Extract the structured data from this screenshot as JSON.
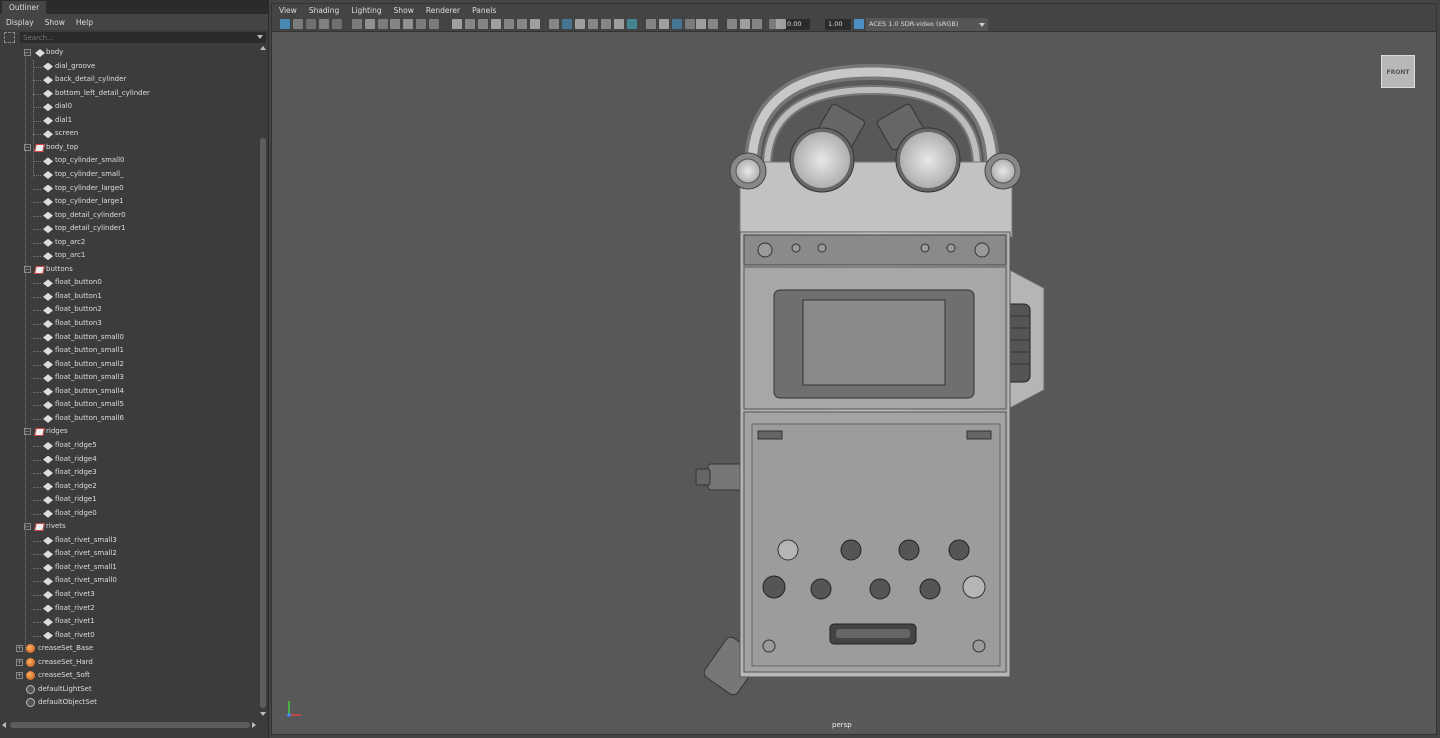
{
  "outliner": {
    "tab": "Outliner",
    "menu": [
      "Display",
      "Show",
      "Help"
    ],
    "search_placeholder": "Search...",
    "tree": [
      {
        "label": "body",
        "type": "mesh",
        "depth": 1,
        "expander": "⊟"
      },
      {
        "label": "dial_groove",
        "type": "mesh",
        "depth": 2
      },
      {
        "label": "back_detail_cylinder",
        "type": "mesh",
        "depth": 2
      },
      {
        "label": "bottom_left_detail_cylinder",
        "type": "mesh",
        "depth": 2
      },
      {
        "label": "dial0",
        "type": "mesh",
        "depth": 2
      },
      {
        "label": "dial1",
        "type": "mesh",
        "depth": 2
      },
      {
        "label": "screen",
        "type": "mesh",
        "depth": 2
      },
      {
        "label": "body_top",
        "type": "group",
        "depth": 1,
        "expander": "⊟"
      },
      {
        "label": "top_cylinder_small0",
        "type": "mesh",
        "depth": 2
      },
      {
        "label": "top_cylinder_small_",
        "type": "mesh",
        "depth": 2
      },
      {
        "label": "top_cylinder_large0",
        "type": "mesh",
        "depth": 2
      },
      {
        "label": "top_cylinder_large1",
        "type": "mesh",
        "depth": 2
      },
      {
        "label": "top_detail_cylinder0",
        "type": "mesh",
        "depth": 2
      },
      {
        "label": "top_detail_cylinder1",
        "type": "mesh",
        "depth": 2
      },
      {
        "label": "top_arc2",
        "type": "mesh",
        "depth": 2
      },
      {
        "label": "top_arc1",
        "type": "mesh",
        "depth": 2
      },
      {
        "label": "buttons",
        "type": "group",
        "depth": 1,
        "expander": "⊟"
      },
      {
        "label": "float_button0",
        "type": "mesh",
        "depth": 2
      },
      {
        "label": "float_button1",
        "type": "mesh",
        "depth": 2
      },
      {
        "label": "float_button2",
        "type": "mesh",
        "depth": 2
      },
      {
        "label": "float_button3",
        "type": "mesh",
        "depth": 2
      },
      {
        "label": "float_button_small0",
        "type": "mesh",
        "depth": 2
      },
      {
        "label": "float_button_small1",
        "type": "mesh",
        "depth": 2
      },
      {
        "label": "float_button_small2",
        "type": "mesh",
        "depth": 2
      },
      {
        "label": "float_button_small3",
        "type": "mesh",
        "depth": 2
      },
      {
        "label": "float_button_small4",
        "type": "mesh",
        "depth": 2
      },
      {
        "label": "float_button_small5",
        "type": "mesh",
        "depth": 2
      },
      {
        "label": "float_button_small6",
        "type": "mesh",
        "depth": 2
      },
      {
        "label": "ridges",
        "type": "group",
        "depth": 1,
        "expander": "⊟"
      },
      {
        "label": "float_ridge5",
        "type": "mesh",
        "depth": 2
      },
      {
        "label": "float_ridge4",
        "type": "mesh",
        "depth": 2
      },
      {
        "label": "float_ridge3",
        "type": "mesh",
        "depth": 2
      },
      {
        "label": "float_ridge2",
        "type": "mesh",
        "depth": 2
      },
      {
        "label": "float_ridge1",
        "type": "mesh",
        "depth": 2
      },
      {
        "label": "float_ridge0",
        "type": "mesh",
        "depth": 2
      },
      {
        "label": "rivets",
        "type": "group",
        "depth": 1,
        "expander": "⊟"
      },
      {
        "label": "float_rivet_small3",
        "type": "mesh",
        "depth": 2
      },
      {
        "label": "float_rivet_small2",
        "type": "mesh",
        "depth": 2
      },
      {
        "label": "float_rivet_small1",
        "type": "mesh",
        "depth": 2
      },
      {
        "label": "float_rivet_small0",
        "type": "mesh",
        "depth": 2
      },
      {
        "label": "float_rivet3",
        "type": "mesh",
        "depth": 2
      },
      {
        "label": "float_rivet2",
        "type": "mesh",
        "depth": 2
      },
      {
        "label": "float_rivet1",
        "type": "mesh",
        "depth": 2
      },
      {
        "label": "float_rivet0",
        "type": "mesh",
        "depth": 2
      },
      {
        "label": "creaseSet_Base",
        "type": "crease",
        "depth": 0,
        "expander": "⊞"
      },
      {
        "label": "creaseSet_Hard",
        "type": "crease",
        "depth": 0,
        "expander": "⊞"
      },
      {
        "label": "creaseSet_Soft",
        "type": "crease",
        "depth": 0,
        "expander": "⊞"
      },
      {
        "label": "defaultLightSet",
        "type": "set",
        "depth": 0
      },
      {
        "label": "defaultObjectSet",
        "type": "set",
        "depth": 0
      }
    ]
  },
  "viewport": {
    "menu": [
      "View",
      "Shading",
      "Lighting",
      "Show",
      "Renderer",
      "Panels"
    ],
    "exposure": "0.00",
    "gamma": "1.00",
    "color_space": "ACES 1.0 SDR-video (sRGB)",
    "view_cube_label": "FRONT",
    "camera_label": "persp"
  },
  "colors": {
    "panel_bg": "#3c3c3c",
    "viewport_bg": "#585858",
    "accent": "#4a90c0"
  }
}
